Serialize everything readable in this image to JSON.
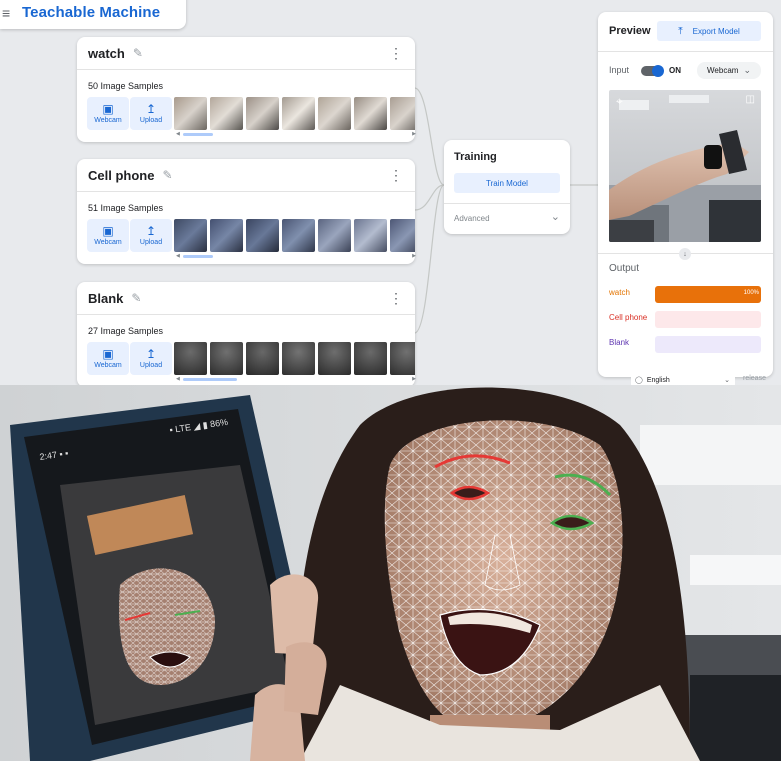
{
  "app": {
    "title": "Teachable Machine",
    "menu_icon": "menu-icon"
  },
  "classes": [
    {
      "name": "watch",
      "samples_label": "50 Image Samples"
    },
    {
      "name": "Cell phone",
      "samples_label": "51 Image Samples"
    },
    {
      "name": "Blank",
      "samples_label": "27 Image Samples"
    }
  ],
  "source_buttons": {
    "webcam": "Webcam",
    "upload": "Upload"
  },
  "training": {
    "title": "Training",
    "train_button": "Train Model",
    "advanced": "Advanced"
  },
  "preview": {
    "title": "Preview",
    "export_button": "Export Model",
    "input_label": "Input",
    "toggle_state": "ON",
    "source_select": "Webcam",
    "output_label": "Output",
    "outputs": [
      {
        "label": "watch",
        "confidence": 1.0,
        "pct_label": "100%",
        "color": "#e8710a"
      },
      {
        "label": "Cell phone",
        "confidence": 0.0,
        "pct_label": "",
        "color": "#e8710a"
      },
      {
        "label": "Blank",
        "confidence": 0.0,
        "pct_label": "",
        "color": "#7c4dff"
      }
    ],
    "label_colors": [
      "#e37400",
      "#d93025",
      "#5e35b1"
    ]
  },
  "footer": {
    "language": "English",
    "release": "release"
  },
  "colors": {
    "brand": "#1967d2",
    "accent_bg": "#e8f0fe",
    "page_bg": "#e8eaed"
  }
}
